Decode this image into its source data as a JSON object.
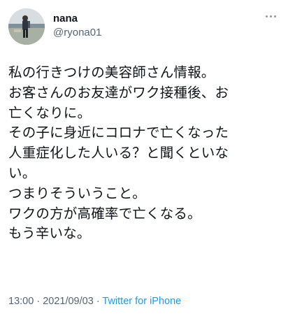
{
  "user": {
    "display_name": "nana",
    "handle": "@ryona01"
  },
  "tweet": {
    "lines": [
      "私の行きつけの美容師さん情報。",
      "お客さんのお友達がワク接種後、お",
      "亡くなりに。",
      "その子に身近にコロナで亡くなった",
      "人重症化した人いる？と聞くといな",
      "い。",
      "つまりそういうこと。",
      "ワクの方が高確率で亡くなる。",
      "もう辛いな。"
    ]
  },
  "meta": {
    "time": "13:00",
    "separator1": " · ",
    "date": "2021/09/03",
    "separator2": " · ",
    "source": "Twitter for iPhone"
  },
  "icons": {
    "more": "more-horizontal-icon"
  },
  "colors": {
    "text": "#0f1419",
    "secondary": "#536471",
    "link": "#1d9bf0"
  }
}
